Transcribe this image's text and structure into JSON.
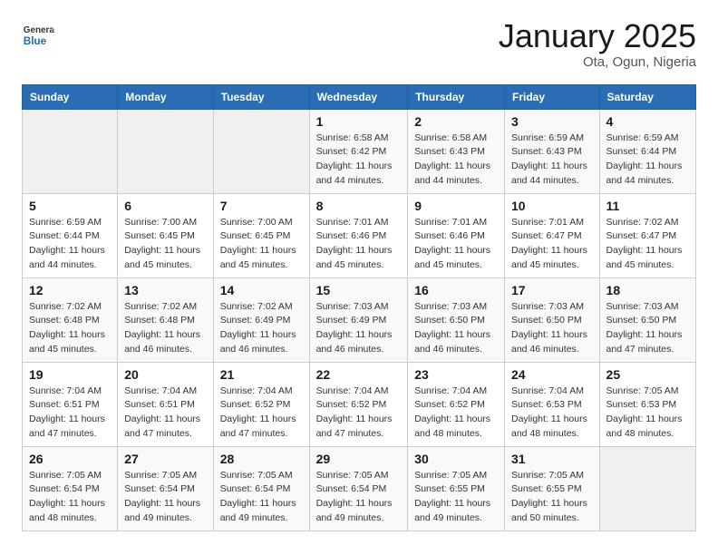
{
  "header": {
    "logo_line1": "General",
    "logo_line2": "Blue",
    "month_title": "January 2025",
    "location": "Ota, Ogun, Nigeria"
  },
  "weekdays": [
    "Sunday",
    "Monday",
    "Tuesday",
    "Wednesday",
    "Thursday",
    "Friday",
    "Saturday"
  ],
  "weeks": [
    [
      {
        "day": "",
        "info": ""
      },
      {
        "day": "",
        "info": ""
      },
      {
        "day": "",
        "info": ""
      },
      {
        "day": "1",
        "info": "Sunrise: 6:58 AM\nSunset: 6:42 PM\nDaylight: 11 hours\nand 44 minutes."
      },
      {
        "day": "2",
        "info": "Sunrise: 6:58 AM\nSunset: 6:43 PM\nDaylight: 11 hours\nand 44 minutes."
      },
      {
        "day": "3",
        "info": "Sunrise: 6:59 AM\nSunset: 6:43 PM\nDaylight: 11 hours\nand 44 minutes."
      },
      {
        "day": "4",
        "info": "Sunrise: 6:59 AM\nSunset: 6:44 PM\nDaylight: 11 hours\nand 44 minutes."
      }
    ],
    [
      {
        "day": "5",
        "info": "Sunrise: 6:59 AM\nSunset: 6:44 PM\nDaylight: 11 hours\nand 44 minutes."
      },
      {
        "day": "6",
        "info": "Sunrise: 7:00 AM\nSunset: 6:45 PM\nDaylight: 11 hours\nand 45 minutes."
      },
      {
        "day": "7",
        "info": "Sunrise: 7:00 AM\nSunset: 6:45 PM\nDaylight: 11 hours\nand 45 minutes."
      },
      {
        "day": "8",
        "info": "Sunrise: 7:01 AM\nSunset: 6:46 PM\nDaylight: 11 hours\nand 45 minutes."
      },
      {
        "day": "9",
        "info": "Sunrise: 7:01 AM\nSunset: 6:46 PM\nDaylight: 11 hours\nand 45 minutes."
      },
      {
        "day": "10",
        "info": "Sunrise: 7:01 AM\nSunset: 6:47 PM\nDaylight: 11 hours\nand 45 minutes."
      },
      {
        "day": "11",
        "info": "Sunrise: 7:02 AM\nSunset: 6:47 PM\nDaylight: 11 hours\nand 45 minutes."
      }
    ],
    [
      {
        "day": "12",
        "info": "Sunrise: 7:02 AM\nSunset: 6:48 PM\nDaylight: 11 hours\nand 45 minutes."
      },
      {
        "day": "13",
        "info": "Sunrise: 7:02 AM\nSunset: 6:48 PM\nDaylight: 11 hours\nand 46 minutes."
      },
      {
        "day": "14",
        "info": "Sunrise: 7:02 AM\nSunset: 6:49 PM\nDaylight: 11 hours\nand 46 minutes."
      },
      {
        "day": "15",
        "info": "Sunrise: 7:03 AM\nSunset: 6:49 PM\nDaylight: 11 hours\nand 46 minutes."
      },
      {
        "day": "16",
        "info": "Sunrise: 7:03 AM\nSunset: 6:50 PM\nDaylight: 11 hours\nand 46 minutes."
      },
      {
        "day": "17",
        "info": "Sunrise: 7:03 AM\nSunset: 6:50 PM\nDaylight: 11 hours\nand 46 minutes."
      },
      {
        "day": "18",
        "info": "Sunrise: 7:03 AM\nSunset: 6:50 PM\nDaylight: 11 hours\nand 47 minutes."
      }
    ],
    [
      {
        "day": "19",
        "info": "Sunrise: 7:04 AM\nSunset: 6:51 PM\nDaylight: 11 hours\nand 47 minutes."
      },
      {
        "day": "20",
        "info": "Sunrise: 7:04 AM\nSunset: 6:51 PM\nDaylight: 11 hours\nand 47 minutes."
      },
      {
        "day": "21",
        "info": "Sunrise: 7:04 AM\nSunset: 6:52 PM\nDaylight: 11 hours\nand 47 minutes."
      },
      {
        "day": "22",
        "info": "Sunrise: 7:04 AM\nSunset: 6:52 PM\nDaylight: 11 hours\nand 47 minutes."
      },
      {
        "day": "23",
        "info": "Sunrise: 7:04 AM\nSunset: 6:52 PM\nDaylight: 11 hours\nand 48 minutes."
      },
      {
        "day": "24",
        "info": "Sunrise: 7:04 AM\nSunset: 6:53 PM\nDaylight: 11 hours\nand 48 minutes."
      },
      {
        "day": "25",
        "info": "Sunrise: 7:05 AM\nSunset: 6:53 PM\nDaylight: 11 hours\nand 48 minutes."
      }
    ],
    [
      {
        "day": "26",
        "info": "Sunrise: 7:05 AM\nSunset: 6:54 PM\nDaylight: 11 hours\nand 48 minutes."
      },
      {
        "day": "27",
        "info": "Sunrise: 7:05 AM\nSunset: 6:54 PM\nDaylight: 11 hours\nand 49 minutes."
      },
      {
        "day": "28",
        "info": "Sunrise: 7:05 AM\nSunset: 6:54 PM\nDaylight: 11 hours\nand 49 minutes."
      },
      {
        "day": "29",
        "info": "Sunrise: 7:05 AM\nSunset: 6:54 PM\nDaylight: 11 hours\nand 49 minutes."
      },
      {
        "day": "30",
        "info": "Sunrise: 7:05 AM\nSunset: 6:55 PM\nDaylight: 11 hours\nand 49 minutes."
      },
      {
        "day": "31",
        "info": "Sunrise: 7:05 AM\nSunset: 6:55 PM\nDaylight: 11 hours\nand 50 minutes."
      },
      {
        "day": "",
        "info": ""
      }
    ]
  ]
}
